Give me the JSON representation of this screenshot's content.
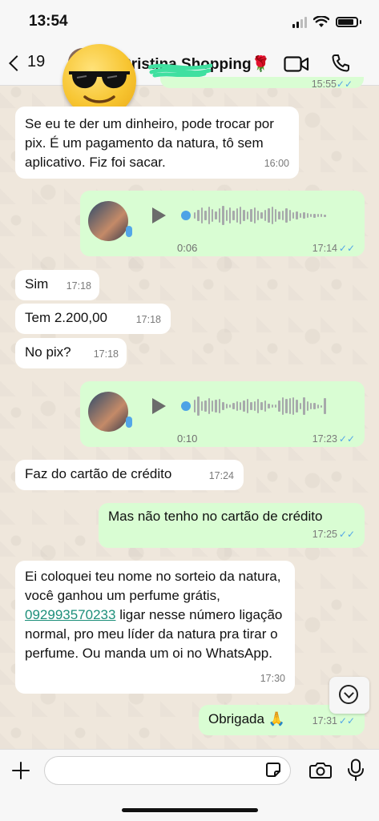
{
  "status_bar": {
    "time": "13:54"
  },
  "header": {
    "back_count": "19",
    "contact_name": "Cristina Shopping🌹"
  },
  "messages": [
    {
      "id": "m0",
      "direction": "out",
      "time": "15:55"
    },
    {
      "id": "m1",
      "direction": "in",
      "text": "Se eu te der um dinheiro, pode trocar por pix. É um pagamento da natura, tô sem aplicativo. Fiz foi sacar.",
      "time": "16:00"
    },
    {
      "id": "m2",
      "direction": "out",
      "type": "voice",
      "duration": "0:06",
      "time": "17:14"
    },
    {
      "id": "m3",
      "direction": "in",
      "text": "Sim",
      "time": "17:18"
    },
    {
      "id": "m4",
      "direction": "in",
      "text": "Tem 2.200,00",
      "time": "17:18"
    },
    {
      "id": "m5",
      "direction": "in",
      "text": "No pix?",
      "time": "17:18"
    },
    {
      "id": "m6",
      "direction": "out",
      "type": "voice",
      "duration": "0:10",
      "time": "17:23"
    },
    {
      "id": "m7",
      "direction": "in",
      "text": "Faz do cartão de crédito",
      "time": "17:24"
    },
    {
      "id": "m8",
      "direction": "out",
      "text": "Mas não tenho no cartão de crédito",
      "time": "17:25"
    },
    {
      "id": "m9",
      "direction": "in",
      "text_before": "Ei coloquei teu nome no sorteio da natura, você ganhou um perfume grátis, ",
      "link": "092993570233",
      "text_after": " ligar nesse número ligação normal, pro meu líder da natura pra tirar o perfume. Ou manda um oi no WhatsApp.",
      "time": "17:30"
    },
    {
      "id": "m10",
      "direction": "out",
      "text": "Obrigada 🙏",
      "time": "17:31"
    }
  ],
  "input": {
    "placeholder": ""
  },
  "colors": {
    "incoming_bubble": "#ffffff",
    "outgoing_bubble": "#d9fdd3",
    "read_ticks": "#53a6e8",
    "link": "#1d8f7a"
  },
  "icons": [
    "back-chevron-icon",
    "video-call-icon",
    "phone-icon",
    "play-icon",
    "microphone-icon",
    "chevron-down-icon",
    "plus-icon",
    "sticker-icon",
    "camera-icon"
  ]
}
